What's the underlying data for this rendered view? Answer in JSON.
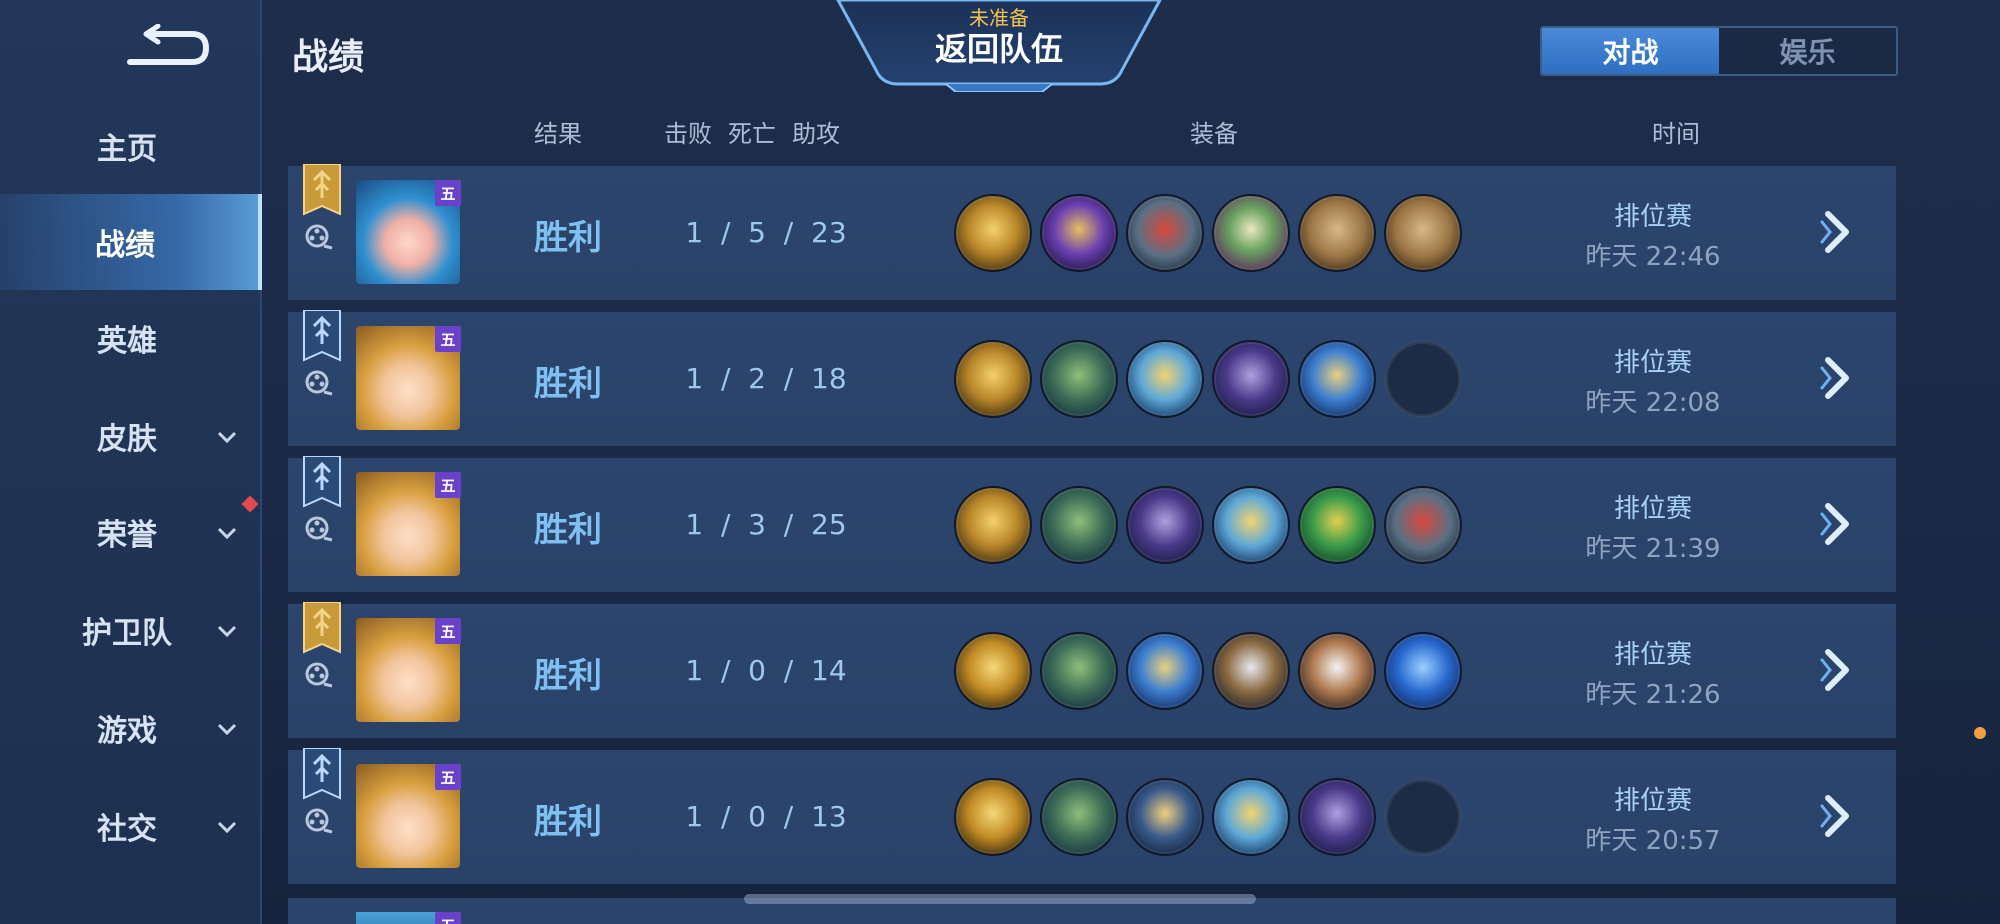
{
  "sidebar": {
    "items": [
      {
        "label": "主页",
        "has_dropdown": false,
        "active": false
      },
      {
        "label": "战绩",
        "has_dropdown": false,
        "active": true
      },
      {
        "label": "英雄",
        "has_dropdown": false,
        "active": false
      },
      {
        "label": "皮肤",
        "has_dropdown": true,
        "active": false
      },
      {
        "label": "荣誉",
        "has_dropdown": true,
        "active": false
      },
      {
        "label": "护卫队",
        "has_dropdown": true,
        "active": false
      },
      {
        "label": "游戏",
        "has_dropdown": true,
        "active": false
      },
      {
        "label": "社交",
        "has_dropdown": true,
        "active": false
      }
    ]
  },
  "header": {
    "title": "战绩",
    "team_status": "未准备",
    "team_return": "返回队伍",
    "mode_tabs": [
      {
        "label": "对战",
        "active": true
      },
      {
        "label": "娱乐",
        "active": false
      }
    ]
  },
  "columns": {
    "result": "结果",
    "kills": "击败",
    "deaths": "死亡",
    "assists": "助攻",
    "items": "装备",
    "time": "时间"
  },
  "matches": [
    {
      "tier_badge": "五",
      "hero": "blue-haired-girl",
      "result": "胜利",
      "kda": "1  /  5  /  23",
      "mode": "排位赛",
      "time": "昨天 22:46",
      "flag": "gold",
      "items": [
        "gold-helm",
        "purple-chalice",
        "red-scarf",
        "spellbook",
        "wooden-plank",
        "wooden-plank"
      ]
    },
    {
      "tier_badge": "五",
      "hero": "blonde-girl",
      "result": "胜利",
      "kda": "1  /  2  /  18",
      "mode": "排位赛",
      "time": "昨天 22:08",
      "flag": "blue",
      "items": [
        "gold-helm",
        "green-boots",
        "gold-wings",
        "purple-cloak",
        "hourglass",
        "empty"
      ]
    },
    {
      "tier_badge": "五",
      "hero": "blonde-girl",
      "result": "胜利",
      "kda": "1  /  3  /  25",
      "mode": "排位赛",
      "time": "昨天 21:39",
      "flag": "blue",
      "items": [
        "gold-helm",
        "green-boots",
        "purple-cloak",
        "gold-wings",
        "green-amulet",
        "red-scarf"
      ]
    },
    {
      "tier_badge": "五",
      "hero": "blonde-girl",
      "result": "胜利",
      "kda": "1  /  0  /  14",
      "mode": "排位赛",
      "time": "昨天 21:26",
      "flag": "gold",
      "items": [
        "gold-crest",
        "green-boots",
        "hourglass",
        "silver-armor",
        "white-armor",
        "blue-crystal"
      ]
    },
    {
      "tier_badge": "五",
      "hero": "blonde-girl",
      "result": "胜利",
      "kda": "1  /  0  /  13",
      "mode": "排位赛",
      "time": "昨天 20:57",
      "flag": "blue",
      "items": [
        "gold-crest",
        "green-boots",
        "pendant",
        "gold-wings",
        "purple-cloak",
        "empty"
      ]
    }
  ],
  "partial_row_badge": "五",
  "colors": {
    "accent": "#4a8ad8",
    "result_win": "#7ec0f2",
    "team_status": "#f2c14e"
  }
}
